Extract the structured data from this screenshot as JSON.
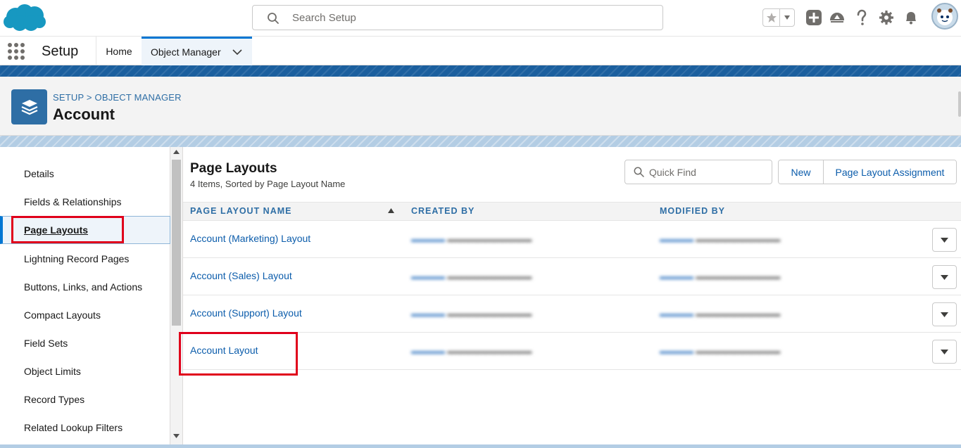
{
  "header": {
    "search_placeholder": "Search Setup"
  },
  "app_nav": {
    "app_name": "Setup",
    "tabs": [
      {
        "label": "Home"
      },
      {
        "label": "Object Manager"
      }
    ]
  },
  "object_header": {
    "breadcrumb": "SETUP > OBJECT MANAGER",
    "title": "Account"
  },
  "sidebar": {
    "items": [
      {
        "label": "Details"
      },
      {
        "label": "Fields & Relationships"
      },
      {
        "label": "Page Layouts"
      },
      {
        "label": "Lightning Record Pages"
      },
      {
        "label": "Buttons, Links, and Actions"
      },
      {
        "label": "Compact Layouts"
      },
      {
        "label": "Field Sets"
      },
      {
        "label": "Object Limits"
      },
      {
        "label": "Record Types"
      },
      {
        "label": "Related Lookup Filters"
      }
    ],
    "active": "Page Layouts"
  },
  "main": {
    "title": "Page Layouts",
    "subtitle": "4 Items, Sorted by Page Layout Name",
    "quick_find_placeholder": "Quick Find",
    "new_button": "New",
    "assignment_button": "Page Layout Assignment",
    "columns": [
      "PAGE LAYOUT NAME",
      "CREATED BY",
      "MODIFIED BY"
    ],
    "rows": [
      {
        "name": "Account (Marketing) Layout"
      },
      {
        "name": "Account (Sales) Layout"
      },
      {
        "name": "Account (Support) Layout"
      },
      {
        "name": "Account Layout"
      }
    ]
  },
  "colors": {
    "brand_blue": "#0176d3",
    "link_blue": "#0b5cab",
    "header_blue": "#2e6ea5",
    "highlight_red": "#e0001b"
  }
}
